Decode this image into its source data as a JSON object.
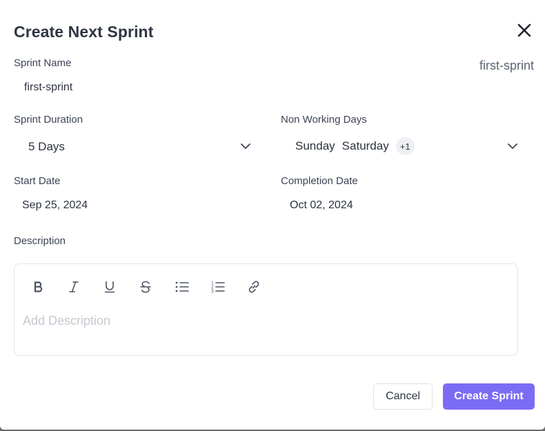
{
  "modal": {
    "title": "Create Next Sprint",
    "slug": "first-sprint"
  },
  "form": {
    "sprint_name": {
      "label": "Sprint Name",
      "value": "first-sprint"
    },
    "duration": {
      "label": "Sprint Duration",
      "value": "5 Days"
    },
    "non_working_days": {
      "label": "Non Working Days",
      "days": [
        "Sunday",
        "Saturday"
      ],
      "more": "+1"
    },
    "start_date": {
      "label": "Start Date",
      "value": "Sep 25, 2024"
    },
    "completion_date": {
      "label": "Completion Date",
      "value": "Oct 02, 2024"
    },
    "description": {
      "label": "Description",
      "placeholder": "Add Description",
      "toolbar": [
        "bold-icon",
        "italic-icon",
        "underline-icon",
        "strikethrough-icon",
        "bullet-list-icon",
        "numbered-list-icon",
        "link-icon"
      ]
    }
  },
  "actions": {
    "cancel_label": "Cancel",
    "create_label": "Create Sprint"
  },
  "colors": {
    "primary": "#7c6cf5",
    "text": "#2c333f",
    "muted": "#c5c9d0"
  }
}
